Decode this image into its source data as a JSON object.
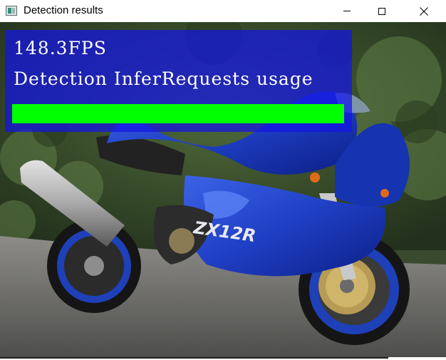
{
  "window": {
    "title": "Detection results",
    "icon": "app-window-icon",
    "controls": [
      "minimize-icon",
      "maximize-icon",
      "close-icon"
    ]
  },
  "overlay": {
    "fps_text": "148.3FPS",
    "usage_label": "Detection InferRequests usage",
    "usage_fraction": 1.0,
    "background_color": "#1414e6",
    "bar_color": "#00ff00",
    "text_color": "#ffffff"
  },
  "image": {
    "subject": "blue sport motorcycle",
    "decal_text": "ZX12R"
  }
}
